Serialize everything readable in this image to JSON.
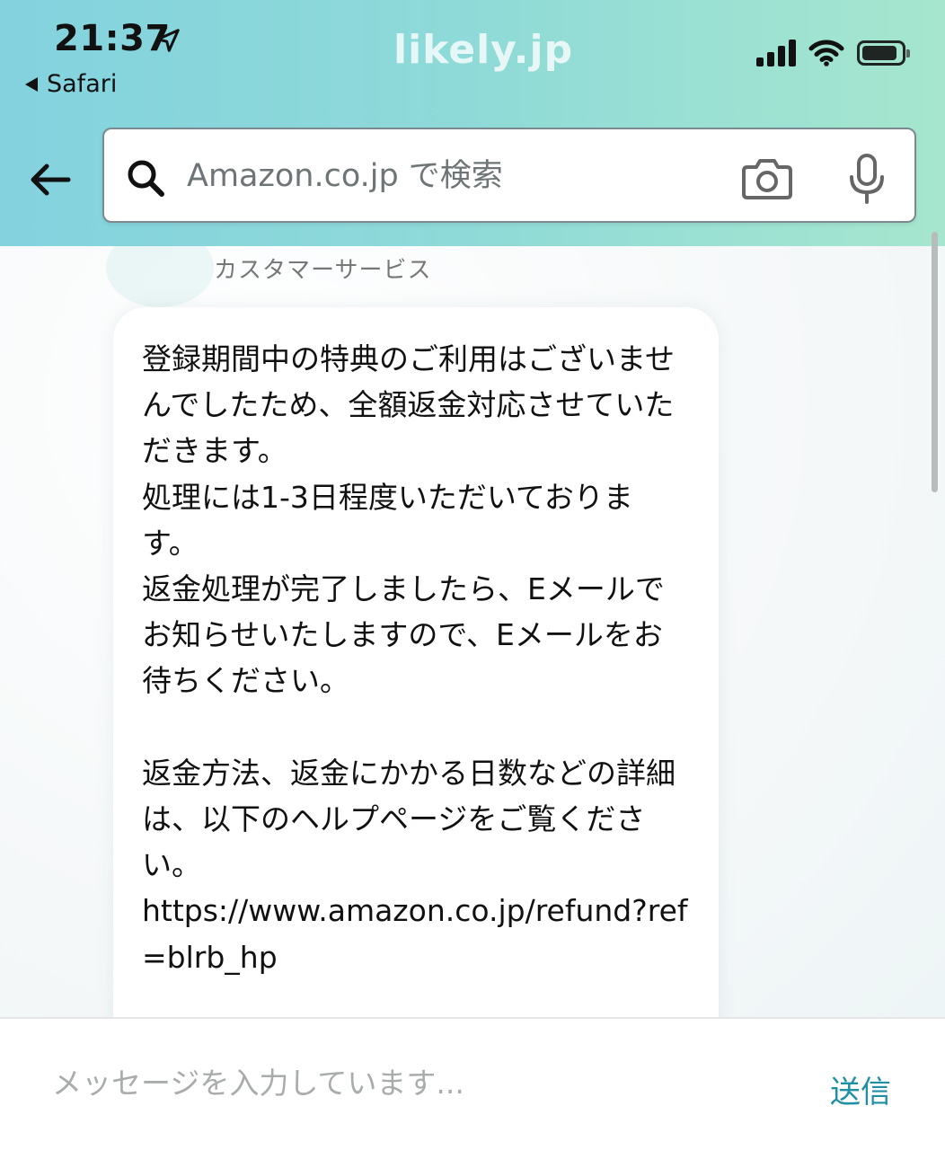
{
  "status_bar": {
    "time": "21:37",
    "back_app": "Safari",
    "watermark": "likely.jp"
  },
  "search": {
    "placeholder": "Amazon.co.jp で検索"
  },
  "chat": {
    "sender": "カスタマーサービス",
    "message": "登録期間中の特典のご利用はございませんでしたため、全額返金対応させていただきます。\n処理には1-3日程度いただいております。\n返金処理が完了しましたら、Eメールでお知らせいたしますので、Eメールをお待ちください。\n\n返金方法、返金にかかる日数などの詳細は、以下のヘルプページをご覧ください。\nhttps://www.amazon.co.jp/refund?ref=blrb_hp"
  },
  "composer": {
    "placeholder": "メッセージを入力しています...",
    "send_label": "送信"
  },
  "colors": {
    "header_gradient_start": "#83d2de",
    "header_gradient_end": "#a6e6ce",
    "send_accent": "#1f8fa3"
  },
  "icons": [
    "location-arrow-icon",
    "cellular-signal-icon",
    "wifi-icon",
    "battery-icon",
    "back-arrow-icon",
    "search-icon",
    "camera-icon",
    "microphone-icon"
  ]
}
